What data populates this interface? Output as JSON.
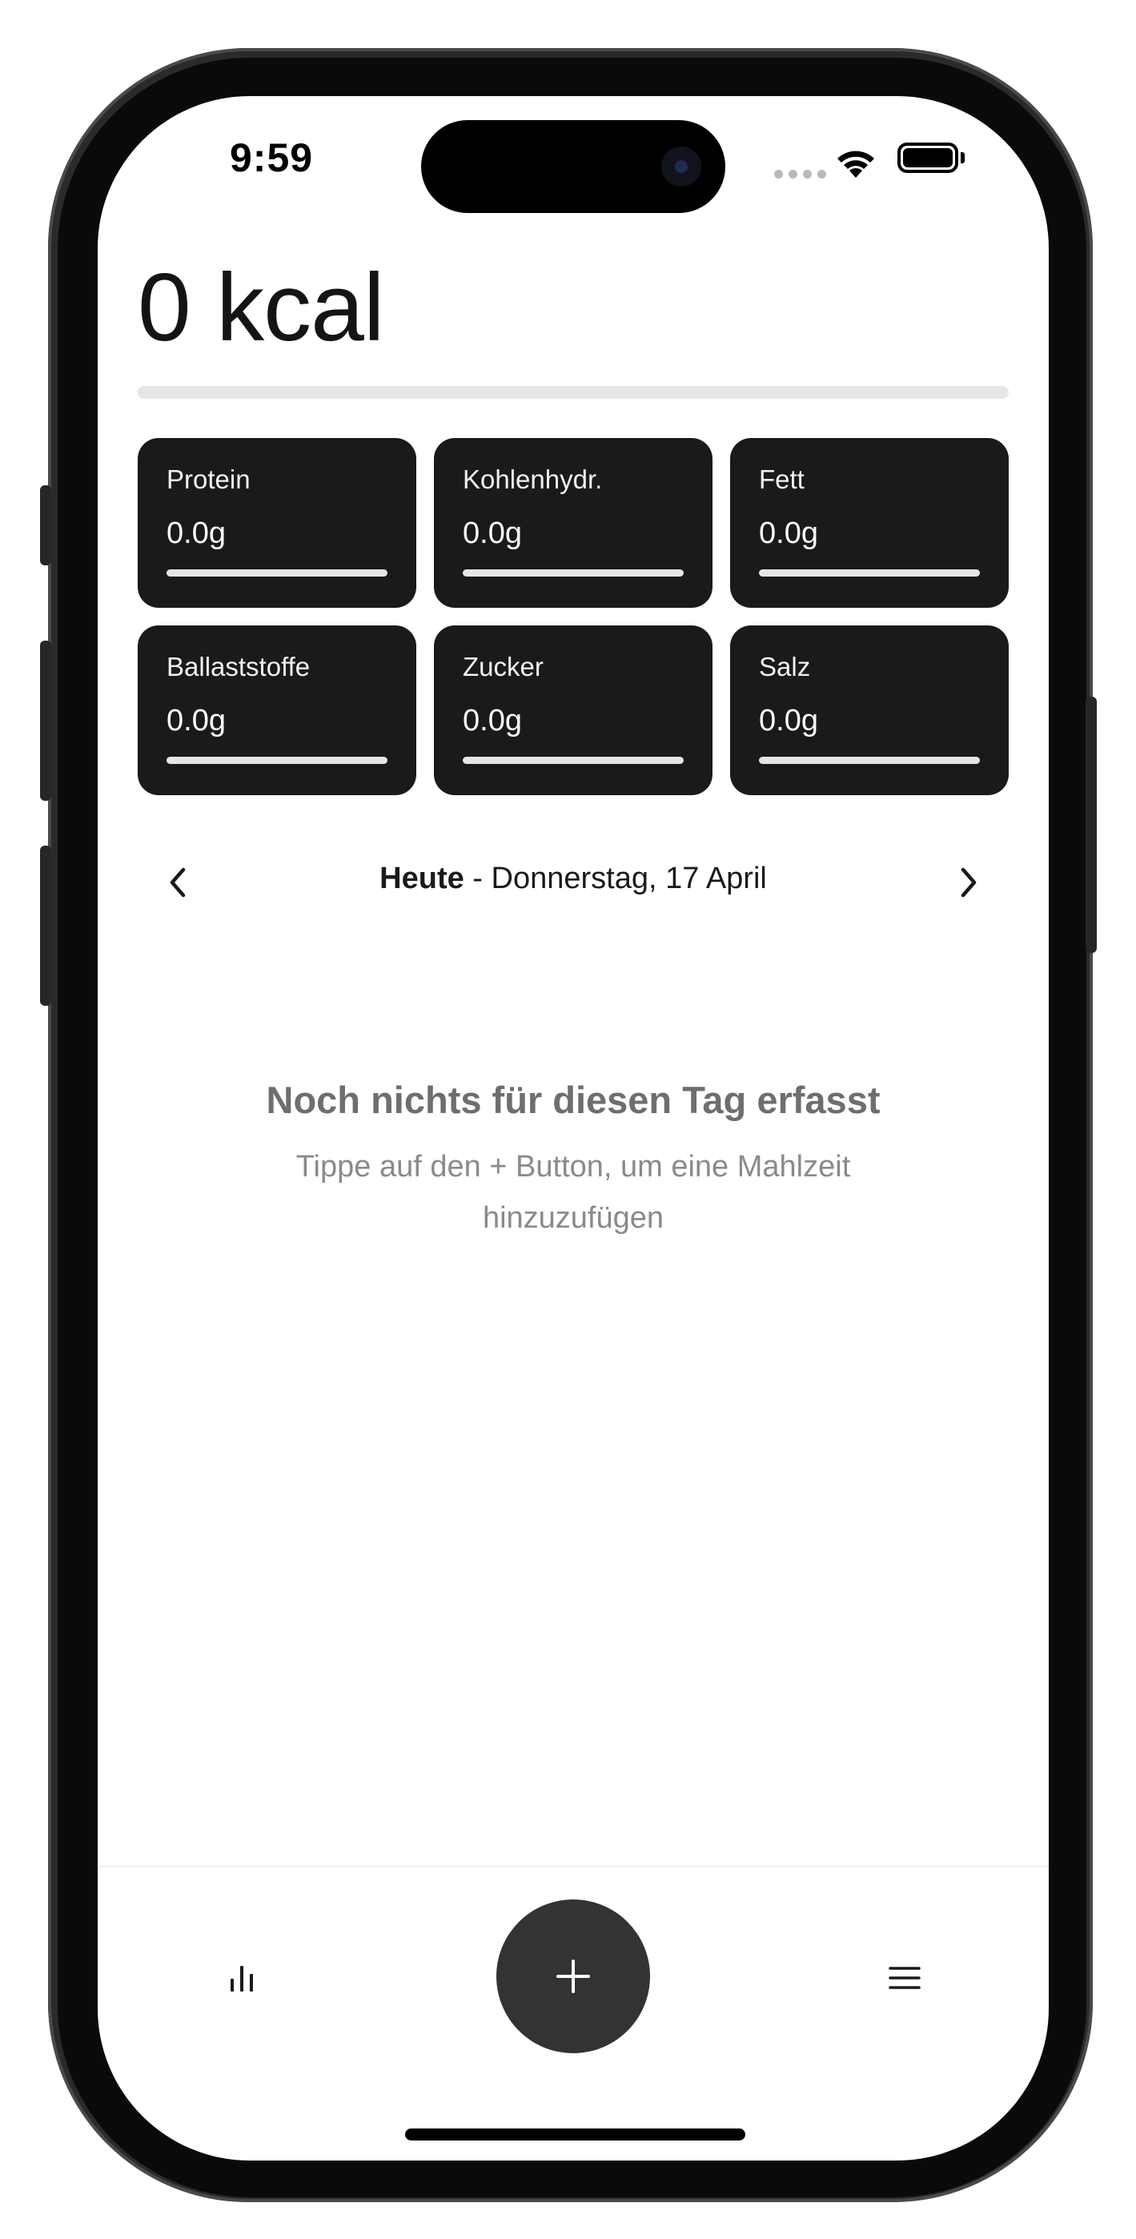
{
  "status_bar": {
    "time": "9:59"
  },
  "calories": {
    "value_label": "0 kcal",
    "progress": 0
  },
  "nutrients": [
    {
      "label": "Protein",
      "value": "0.0g",
      "progress": 0
    },
    {
      "label": "Kohlenhydr.",
      "value": "0.0g",
      "progress": 0
    },
    {
      "label": "Fett",
      "value": "0.0g",
      "progress": 0
    },
    {
      "label": "Ballaststoffe",
      "value": "0.0g",
      "progress": 0
    },
    {
      "label": "Zucker",
      "value": "0.0g",
      "progress": 0
    },
    {
      "label": "Salz",
      "value": "0.0g",
      "progress": 0
    }
  ],
  "date_nav": {
    "today_label": "Heute",
    "separator": " - ",
    "date_text": "Donnerstag, 17 April",
    "prev_icon": "chevron-left-icon",
    "next_icon": "chevron-right-icon"
  },
  "empty_state": {
    "title": "Noch nichts für diesen Tag erfasst",
    "subtitle": "Tippe auf den + Button, um eine Mahlzeit hinzuzufügen"
  },
  "bottom_bar": {
    "left_icon": "bar-chart-icon",
    "center_icon": "plus-icon",
    "right_icon": "menu-icon"
  },
  "colors": {
    "card_background": "#1a1a1a",
    "fab_background": "#333333",
    "track": "#e6e6e6",
    "empty_title": "#6e6e6e",
    "empty_subtitle": "#8a8a8a"
  }
}
